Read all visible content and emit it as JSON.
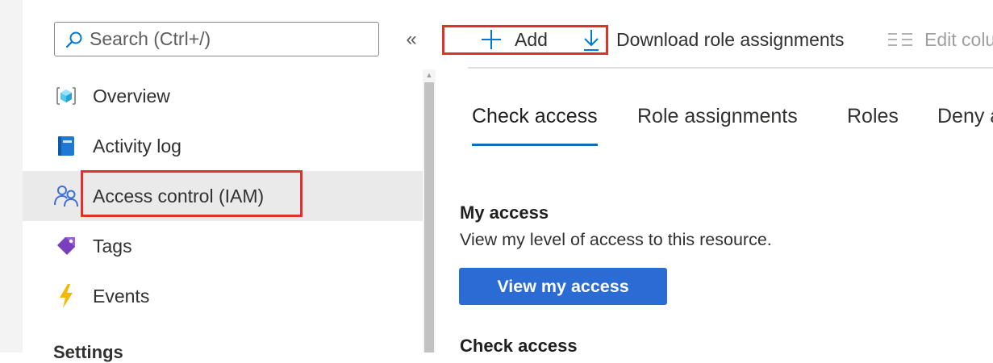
{
  "sidebar": {
    "search": {
      "placeholder": "Search (Ctrl+/)",
      "value": ""
    },
    "collapse_label": "«",
    "items": [
      {
        "label": "Overview",
        "icon": "overview-cube-icon"
      },
      {
        "label": "Activity log",
        "icon": "activity-log-book-icon"
      },
      {
        "label": "Access control (IAM)",
        "icon": "users-iam-icon",
        "active": true
      },
      {
        "label": "Tags",
        "icon": "tag-icon"
      },
      {
        "label": "Events",
        "icon": "lightning-icon"
      }
    ],
    "section_heading": "Settings"
  },
  "toolbar": {
    "add_label": "Add",
    "download_label": "Download role assignments",
    "edit_columns_label": "Edit columns"
  },
  "tabs": [
    {
      "label": "Check access",
      "active": true
    },
    {
      "label": "Role assignments"
    },
    {
      "label": "Roles"
    },
    {
      "label": "Deny assignments"
    }
  ],
  "main": {
    "my_access_title": "My access",
    "my_access_desc": "View my level of access to this resource.",
    "view_my_access_button": "View my access",
    "check_access_title": "Check access"
  },
  "colors": {
    "highlight_box": "#e0322a",
    "primary_button": "#2b6cd4",
    "tab_underline": "#0f6cbd",
    "icon_blue": "#0078d4"
  }
}
